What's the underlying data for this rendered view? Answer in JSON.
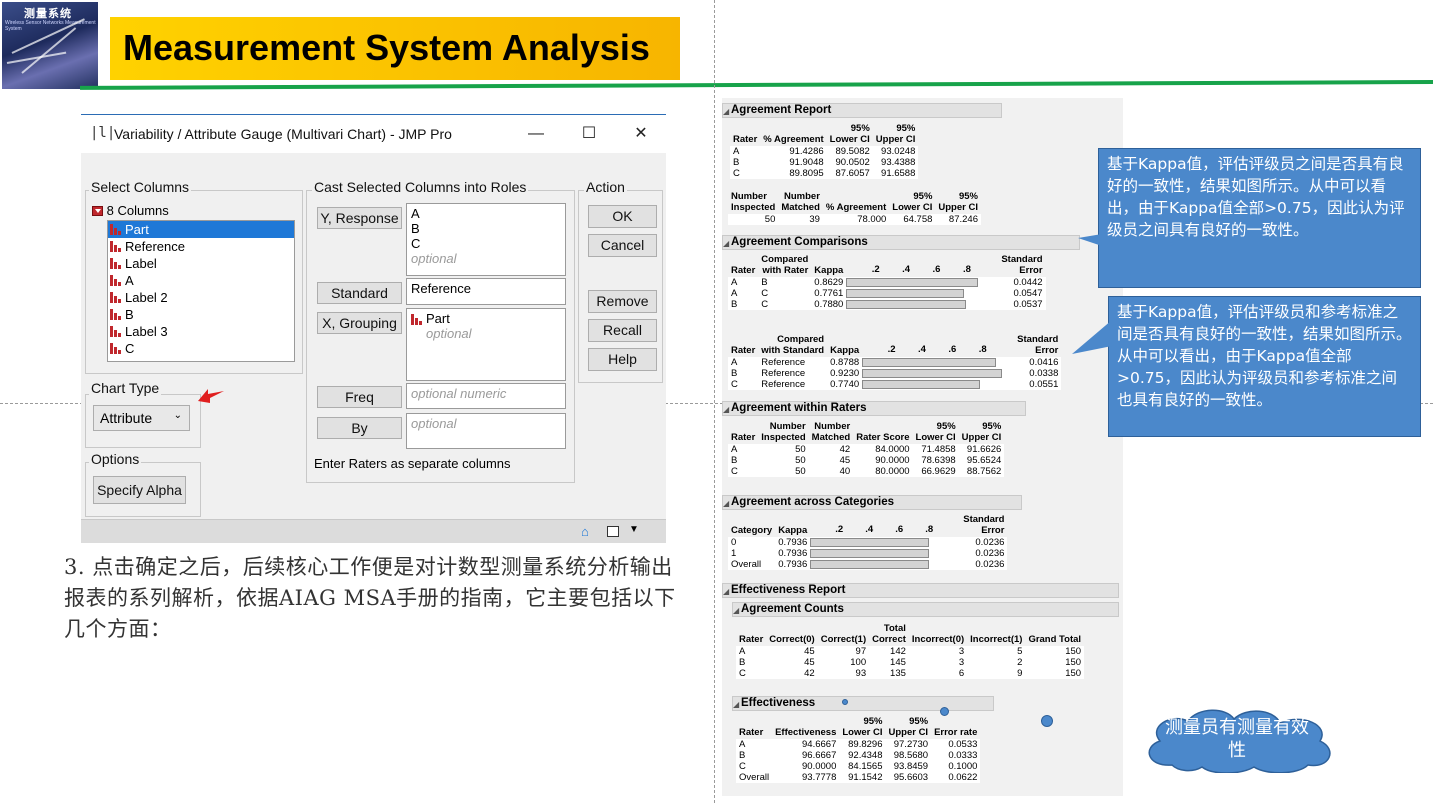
{
  "slide": {
    "title": "Measurement System Analysis",
    "logo_title": "测量系统",
    "logo_sub": "Wireless Sensor Networks Measurement System",
    "note": "3. 点击确定之后，后续核心工作便是对计数型测量系统分析输出报表的系列解析，依据AIAG MSA手册的指南，它主要包括以下几个方面："
  },
  "dialog": {
    "icon": "|l|",
    "title": "Variability / Attribute Gauge (Multivari Chart) - JMP Pro",
    "minimize": "—",
    "maximize": "☐",
    "close": "✕",
    "select_columns_label": "Select Columns",
    "columns_count": "8 Columns",
    "columns": [
      "Part",
      "Reference",
      "Label",
      "A",
      "Label 2",
      "B",
      "Label 3",
      "C"
    ],
    "cast_label": "Cast Selected Columns into Roles",
    "roles": {
      "y_response_button": "Y, Response",
      "y_response_values": [
        "A",
        "B",
        "C"
      ],
      "y_response_placeholder": "optional",
      "standard_button": "Standard",
      "standard_value": "Reference",
      "x_grouping_button": "X, Grouping",
      "x_grouping_value": "Part",
      "x_grouping_placeholder": "optional",
      "freq_button": "Freq",
      "freq_placeholder": "optional numeric",
      "by_button": "By",
      "by_placeholder": "optional"
    },
    "raters_note": "Enter Raters as separate columns",
    "action_label": "Action",
    "actions": [
      "OK",
      "Cancel",
      "Remove",
      "Recall",
      "Help"
    ],
    "chart_type_label": "Chart Type",
    "chart_type_value": "Attribute",
    "options_label": "Options",
    "specify_alpha": "Specify Alpha"
  },
  "report": {
    "agreement_report": {
      "title": "Agreement Report",
      "headers": [
        "Rater",
        "% Agreement",
        "95%\nLower CI",
        "95%\nUpper CI"
      ],
      "rows": [
        [
          "A",
          "91.4286",
          "89.5082",
          "93.0248"
        ],
        [
          "B",
          "91.9048",
          "90.0502",
          "93.4388"
        ],
        [
          "C",
          "89.8095",
          "87.6057",
          "91.6588"
        ]
      ],
      "sum_headers": [
        "Number\nInspected",
        "Number\nMatched",
        "% Agreement",
        "95%\nLower CI",
        "95%\nUpper CI"
      ],
      "sum_row": [
        "50",
        "39",
        "78.000",
        "64.758",
        "87.246"
      ]
    },
    "agreement_comparisons": {
      "title": "Agreement Comparisons",
      "headers": [
        "Rater",
        "Compared\nwith Rater",
        "Kappa",
        "Standard\nError"
      ],
      "axis": [
        ".2",
        ".4",
        ".6",
        ".8"
      ],
      "rows": [
        [
          "A",
          "B",
          0.8629,
          "0.0442"
        ],
        [
          "A",
          "C",
          0.7761,
          "0.0547"
        ],
        [
          "B",
          "C",
          0.788,
          "0.0537"
        ]
      ],
      "kappa_text": [
        "0.8629",
        "0.7761",
        "0.7880"
      ],
      "std_headers": [
        "Rater",
        "Compared\nwith Standard",
        "Kappa",
        "Standard\nError"
      ],
      "std_rows": [
        [
          "A",
          "Reference",
          0.8788,
          "0.0416"
        ],
        [
          "B",
          "Reference",
          0.923,
          "0.0338"
        ],
        [
          "C",
          "Reference",
          0.774,
          "0.0551"
        ]
      ],
      "std_kappa_text": [
        "0.8788",
        "0.9230",
        "0.7740"
      ]
    },
    "agreement_within": {
      "title": "Agreement within Raters",
      "headers": [
        "Rater",
        "Number\nInspected",
        "Number\nMatched",
        "Rater Score",
        "95%\nLower CI",
        "95%\nUpper CI"
      ],
      "rows": [
        [
          "A",
          "50",
          "42",
          "84.0000",
          "71.4858",
          "91.6626"
        ],
        [
          "B",
          "50",
          "45",
          "90.0000",
          "78.6398",
          "95.6524"
        ],
        [
          "C",
          "50",
          "40",
          "80.0000",
          "66.9629",
          "88.7562"
        ]
      ]
    },
    "agreement_across": {
      "title": "Agreement across Categories",
      "headers": [
        "Category",
        "Kappa",
        "Standard\nError"
      ],
      "axis": [
        ".2",
        ".4",
        ".6",
        ".8"
      ],
      "rows": [
        [
          "0",
          0.7936,
          "0.0236"
        ],
        [
          "1",
          0.7936,
          "0.0236"
        ],
        [
          "Overall",
          0.7936,
          "0.0236"
        ]
      ],
      "kappa_text": [
        "0.7936",
        "0.7936",
        "0.7936"
      ]
    },
    "effectiveness_report": {
      "title": "Effectiveness Report",
      "counts_title": "Agreement Counts",
      "counts_headers": [
        "Rater",
        "Correct(0)",
        "Correct(1)",
        "Total\nCorrect",
        "Incorrect(0)",
        "Incorrect(1)",
        "Grand Total"
      ],
      "counts_rows": [
        [
          "A",
          "45",
          "97",
          "142",
          "3",
          "5",
          "150"
        ],
        [
          "B",
          "45",
          "100",
          "145",
          "3",
          "2",
          "150"
        ],
        [
          "C",
          "42",
          "93",
          "135",
          "6",
          "9",
          "150"
        ]
      ],
      "eff_title": "Effectiveness",
      "eff_headers": [
        "Rater",
        "Effectiveness",
        "95%\nLower CI",
        "95%\nUpper CI",
        "Error rate"
      ],
      "eff_rows": [
        [
          "A",
          "94.6667",
          "89.8296",
          "97.2730",
          "0.0533"
        ],
        [
          "B",
          "96.6667",
          "92.4348",
          "98.5680",
          "0.0333"
        ],
        [
          "C",
          "90.0000",
          "84.1565",
          "93.8459",
          "0.1000"
        ],
        [
          "Overall",
          "93.7778",
          "91.1542",
          "95.6603",
          "0.0622"
        ]
      ]
    }
  },
  "callouts": {
    "kappa_raters": "基于Kappa值，评估评级员之间是否具有良好的一致性，结果如图所示。从中可以看出，由于Kappa值全部>0.75，因此认为评级员之间具有良好的一致性。",
    "kappa_standard": "基于Kappa值，评估评级员和参考标准之间是否具有良好的一致性，结果如图所示。从中可以看出，由于Kappa值全部>0.75，因此认为评级员和参考标准之间也具有良好的一致性。",
    "cloud": "测量员有测量有效性"
  },
  "colors": {
    "title_bg": "#ffd200",
    "callout_bg": "#4b88cb",
    "accent_line": "#17a34a",
    "selection": "#1e78d7"
  }
}
